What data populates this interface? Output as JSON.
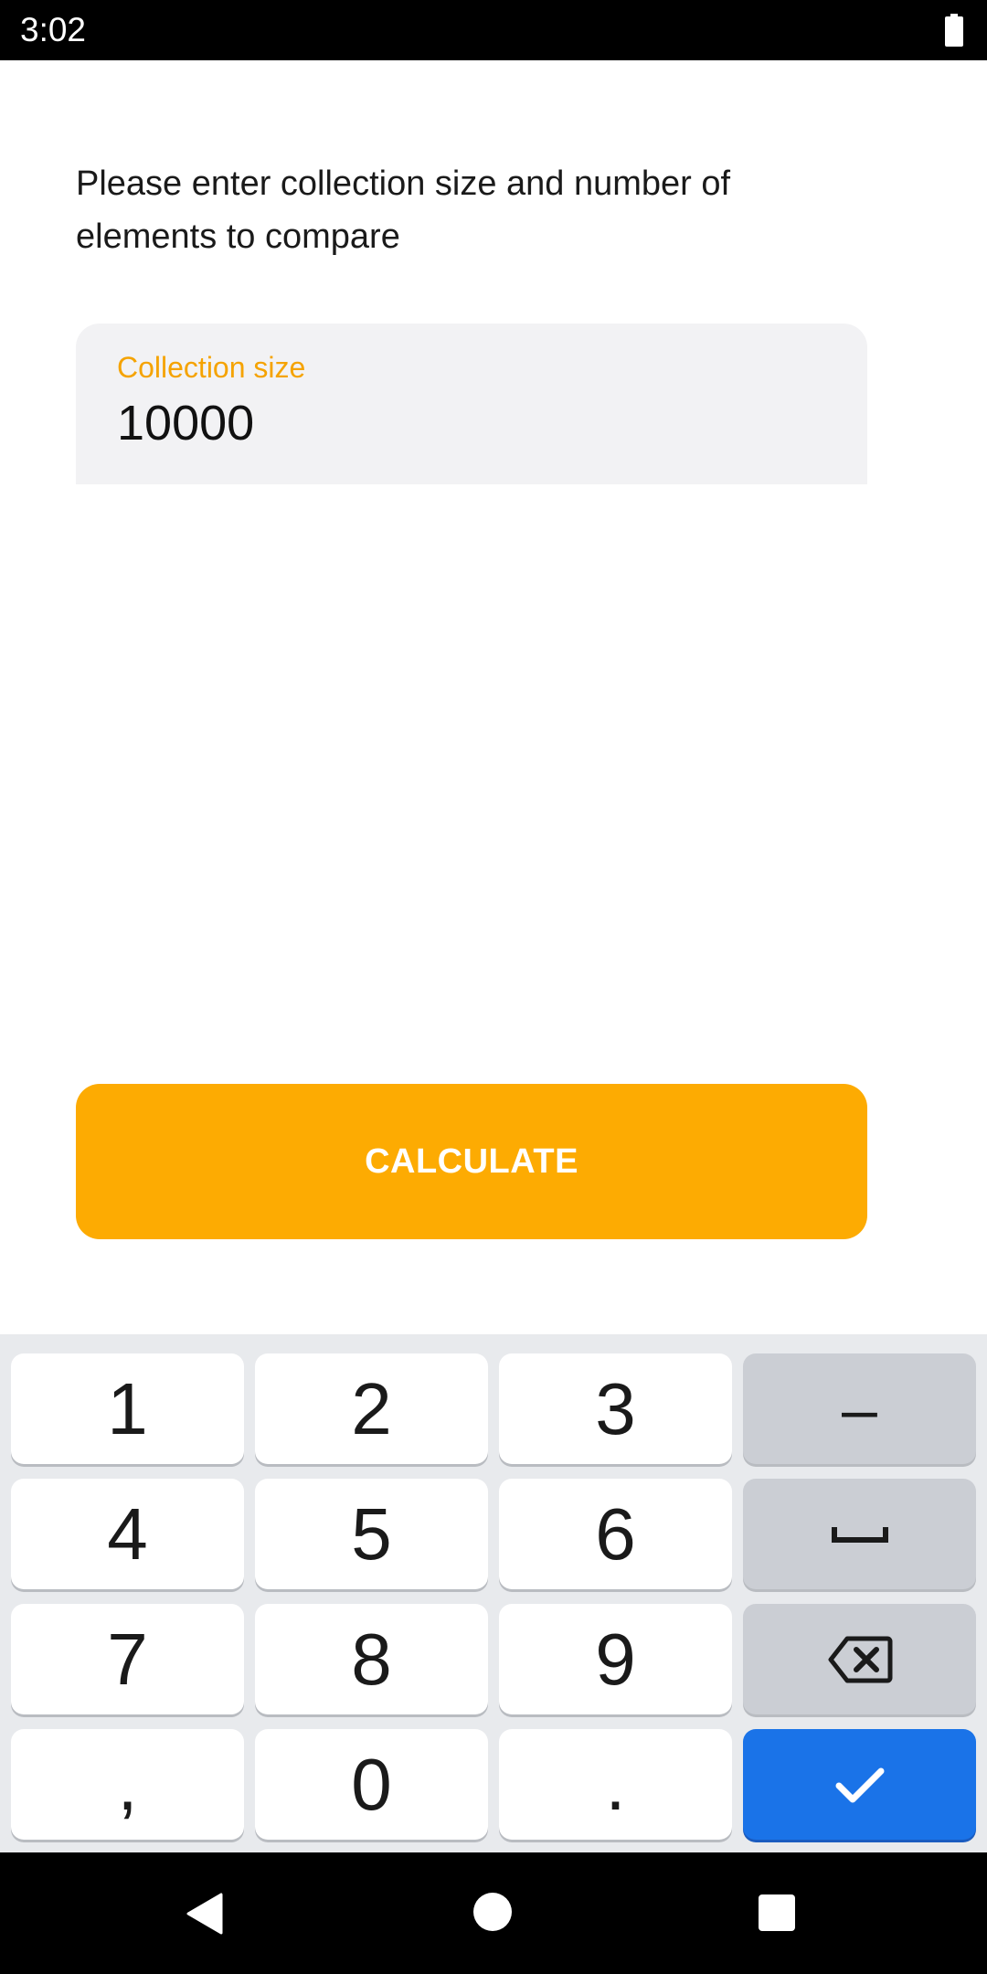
{
  "status_bar": {
    "time": "3:02",
    "battery_icon": "battery-full-icon"
  },
  "content": {
    "instructions": "Please enter collection size and number of elements to compare",
    "input": {
      "label": "Collection size",
      "value": "10000"
    },
    "calculate_label": "CALCULATE"
  },
  "keyboard": {
    "rows": [
      [
        "1",
        "2",
        "3",
        "–"
      ],
      [
        "4",
        "5",
        "6",
        "space"
      ],
      [
        "7",
        "8",
        "9",
        "backspace"
      ],
      [
        ",",
        "0",
        ".",
        "done"
      ]
    ],
    "keys": {
      "k1": "1",
      "k2": "2",
      "k3": "3",
      "minus": "–",
      "k4": "4",
      "k5": "5",
      "k6": "6",
      "k7": "7",
      "k8": "8",
      "k9": "9",
      "comma": ",",
      "k0": "0",
      "period": "."
    },
    "icons": {
      "space": "space-bar-icon",
      "backspace": "backspace-icon",
      "done": "checkmark-icon"
    }
  },
  "nav_bar": {
    "icons": [
      "back-triangle-icon",
      "home-circle-icon",
      "recents-square-icon"
    ]
  },
  "colors": {
    "accent": "#fdab02",
    "label": "#f5a300",
    "enter_key": "#1a73e8"
  }
}
